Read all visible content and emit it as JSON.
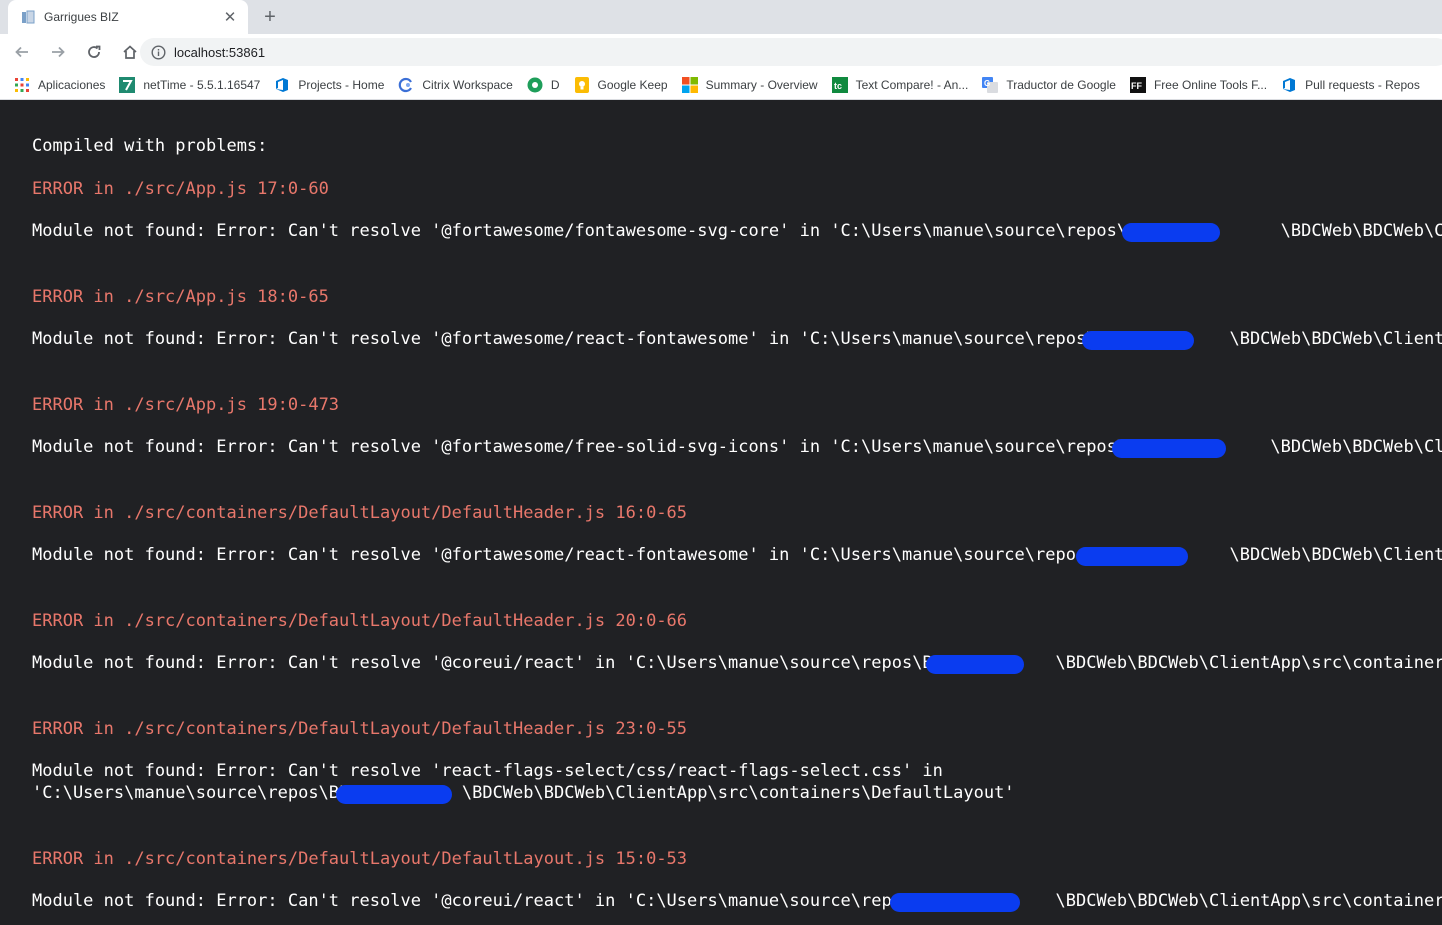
{
  "tab": {
    "title": "Garrigues BIZ",
    "close": "✕"
  },
  "new_tab": "+",
  "address_bar": {
    "url": "localhost:53861"
  },
  "bookmarks": [
    {
      "label": "Aplicaciones",
      "icon": "apps-grid-icon"
    },
    {
      "label": "netTime - 5.5.1.16547",
      "icon": "nettime-icon"
    },
    {
      "label": "Projects - Home",
      "icon": "azure-devops-icon"
    },
    {
      "label": "Citrix Workspace",
      "icon": "citrix-icon"
    },
    {
      "label": "D",
      "icon": "d-icon"
    },
    {
      "label": "Google Keep",
      "icon": "google-keep-icon"
    },
    {
      "label": "Summary - Overview",
      "icon": "summary-icon"
    },
    {
      "label": "Text Compare! - An...",
      "icon": "text-compare-icon"
    },
    {
      "label": "Traductor de Google",
      "icon": "google-translate-icon"
    },
    {
      "label": "Free Online Tools F...",
      "icon": "ff-icon"
    },
    {
      "label": "Pull requests - Repos",
      "icon": "azure-devops-icon"
    }
  ],
  "overlay": {
    "title": "Compiled with problems:",
    "errors": [
      {
        "heading": "ERROR in ./src/App.js 17:0-60",
        "message": "Module not found: Error: Can't resolve '@fortawesome/fontawesome-svg-core' in 'C:\\Users\\manue\\source\\repos\\BIZ_           \\BDCWeb\\BDCWeb\\ClientApp\\s"
      },
      {
        "heading": "ERROR in ./src/App.js 18:0-65",
        "message": "Module not found: Error: Can't resolve '@fortawesome/react-fontawesome' in 'C:\\Users\\manue\\source\\repos\\BI           \\BDCWeb\\BDCWeb\\ClientApp\\s"
      },
      {
        "heading": "ERROR in ./src/App.js 19:0-473",
        "message": "Module not found: Error: Can't resolve '@fortawesome/free-solid-svg-icons' in 'C:\\Users\\manue\\source\\repos\\BI            \\BDCWeb\\BDCWeb\\ClientAp"
      },
      {
        "heading": "ERROR in ./src/containers/DefaultLayout/DefaultHeader.js 16:0-65",
        "message": "Module not found: Error: Can't resolve '@fortawesome/react-fontawesome' in 'C:\\Users\\manue\\source\\repos\\BI           \\BDCWeb\\BDCWeb\\ClientApp\\s"
      },
      {
        "heading": "ERROR in ./src/containers/DefaultLayout/DefaultHeader.js 20:0-66",
        "message": "Module not found: Error: Can't resolve '@coreui/react' in 'C:\\Users\\manue\\source\\repos\\BIZ          \\BDCWeb\\BDCWeb\\ClientApp\\src\\containers\\Def"
      },
      {
        "heading": "ERROR in ./src/containers/DefaultLayout/DefaultHeader.js 23:0-55",
        "message": "Module not found: Error: Can't resolve 'react-flags-select/css/react-flags-select.css' in\n'C:\\Users\\manue\\source\\repos\\BI           \\BDCWeb\\BDCWeb\\ClientApp\\src\\containers\\DefaultLayout'"
      },
      {
        "heading": "ERROR in ./src/containers/DefaultLayout/DefaultLayout.js 15:0-53",
        "message": "Module not found: Error: Can't resolve '@coreui/react' in 'C:\\Users\\manue\\source\\repos\\             \\BDCWeb\\BDCWeb\\ClientApp\\src\\containers\\Def"
      }
    ]
  }
}
